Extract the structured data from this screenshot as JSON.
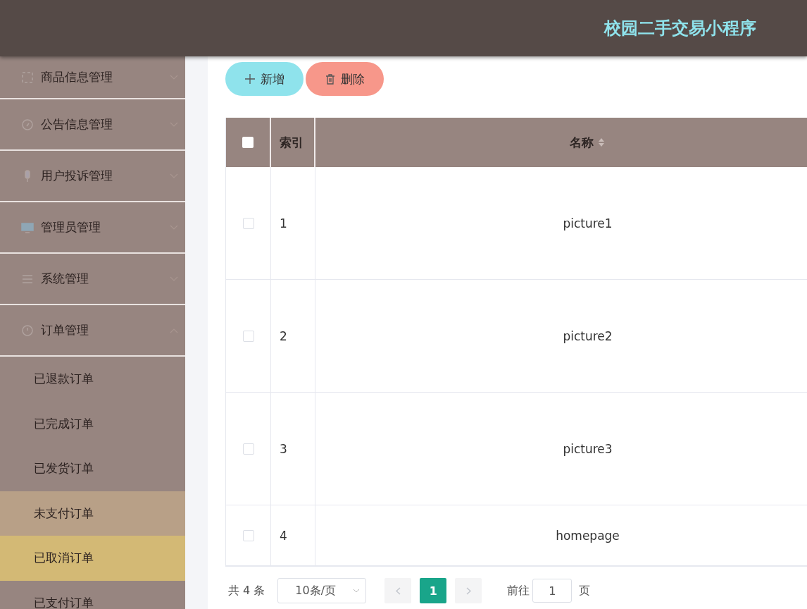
{
  "header": {
    "title": "校园二手交易小程序"
  },
  "sidebar": {
    "items": [
      {
        "label": "商品信息管理",
        "kind": "square",
        "expanded": false
      },
      {
        "label": "公告信息管理",
        "kind": "compass",
        "expanded": false
      },
      {
        "label": "用户投诉管理",
        "kind": "mic",
        "expanded": false
      },
      {
        "label": "管理员管理",
        "kind": "monitor",
        "expanded": false
      },
      {
        "label": "系统管理",
        "kind": "sliders",
        "expanded": false
      },
      {
        "label": "订单管理",
        "kind": "clock",
        "expanded": true,
        "children": [
          {
            "label": "已退款订单",
            "selected": false,
            "hovered": false
          },
          {
            "label": "已完成订单",
            "selected": false,
            "hovered": false
          },
          {
            "label": "已发货订单",
            "selected": false,
            "hovered": false
          },
          {
            "label": "未支付订单",
            "selected": false,
            "hovered": true
          },
          {
            "label": "已取消订单",
            "selected": true,
            "hovered": false
          },
          {
            "label": "已支付订单",
            "selected": false,
            "hovered": false
          }
        ]
      }
    ]
  },
  "toolbar": {
    "buttons": [
      {
        "label": "新增",
        "kind": "add"
      },
      {
        "label": "删除",
        "kind": "delete"
      }
    ]
  },
  "table": {
    "header_checked": false,
    "columns": [
      "索引",
      "名称"
    ],
    "rows": [
      {
        "checked": false,
        "index": "1",
        "name": "picture1"
      },
      {
        "checked": false,
        "index": "2",
        "name": "picture2"
      },
      {
        "checked": false,
        "index": "3",
        "name": "picture3"
      },
      {
        "checked": false,
        "index": "4",
        "name": "homepage"
      }
    ]
  },
  "pagination": {
    "total": "共 4 条",
    "page_size": "10条/页",
    "pages": [
      {
        "label": "1",
        "selected": true
      }
    ],
    "goto_label": "前往",
    "goto_value": "1",
    "page_suffix": "页"
  }
}
